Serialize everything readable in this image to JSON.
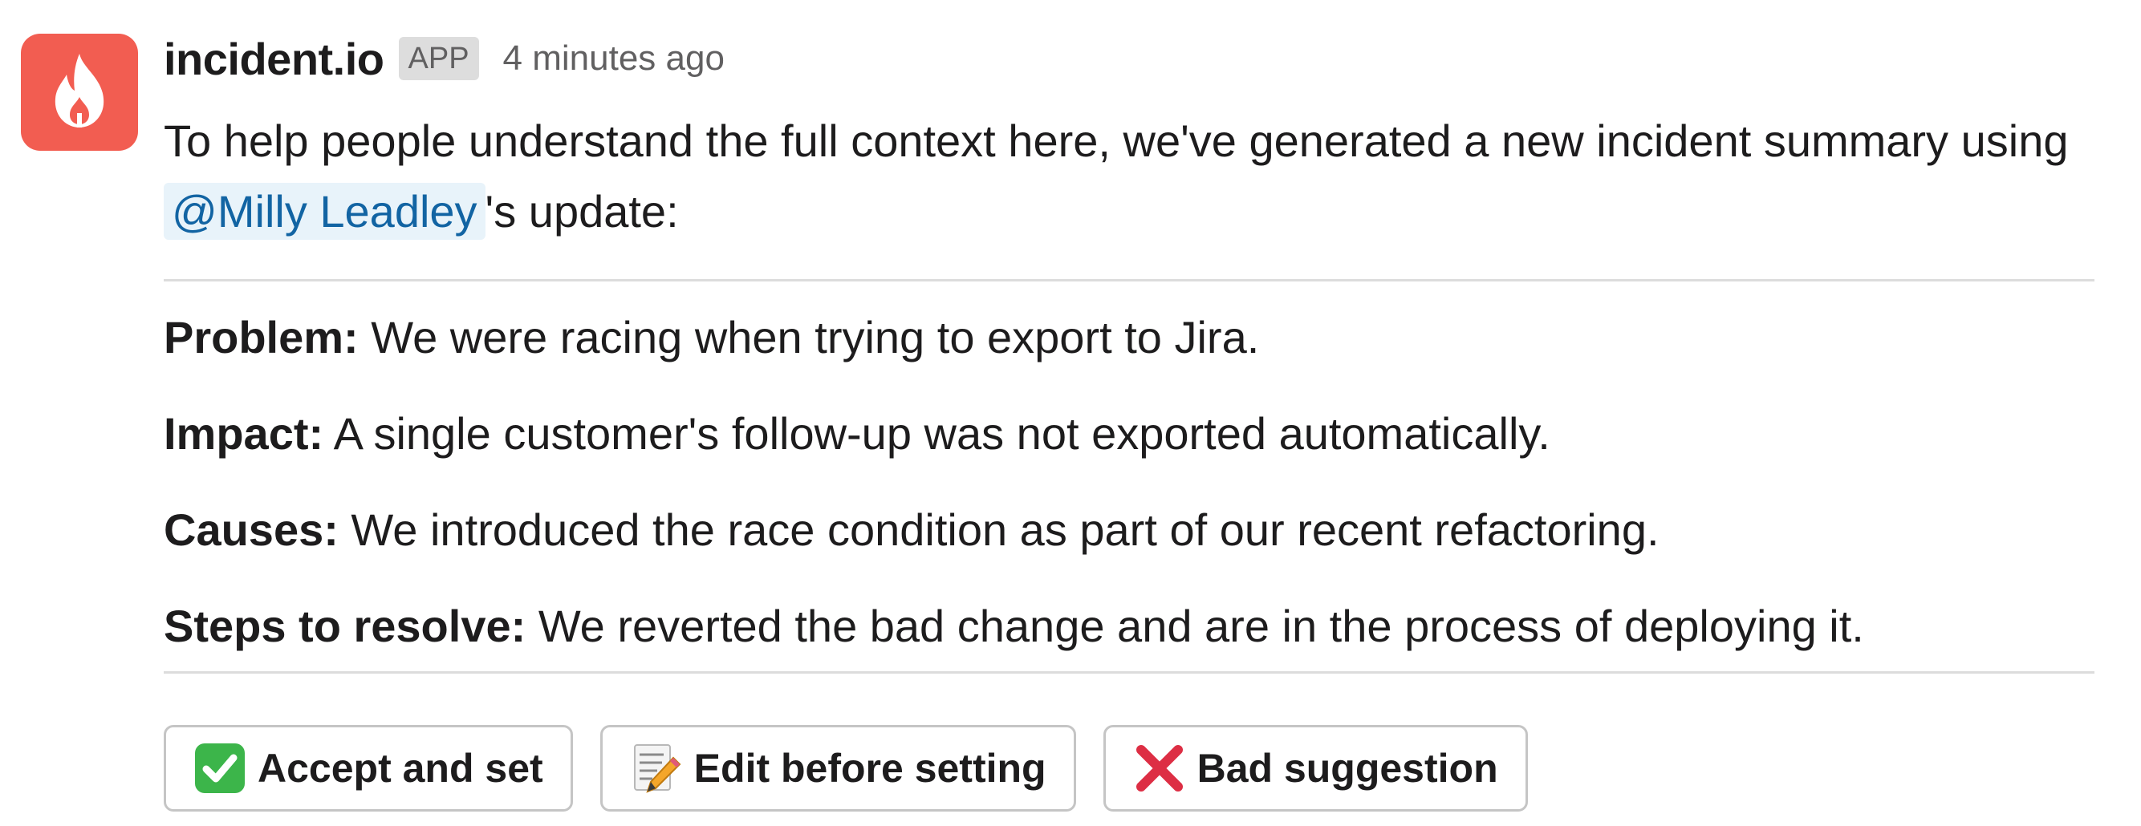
{
  "message": {
    "app_name": "incident.io",
    "app_badge": "APP",
    "timestamp": "4 minutes ago",
    "avatar_icon": "flame-icon",
    "intro_before": "To help people understand the full context here, we've generated a new incident summary using ",
    "mention": "@Milly Leadley",
    "intro_after": "'s update:"
  },
  "summary": {
    "problem": {
      "label": "Problem:",
      "text": " We were racing when trying to export to Jira."
    },
    "impact": {
      "label": "Impact:",
      "text": " A single customer's follow-up was not exported automatically."
    },
    "causes": {
      "label": "Causes:",
      "text": " We introduced the race condition as part of our recent refactoring."
    },
    "steps": {
      "label": "Steps to resolve:",
      "text": " We reverted the bad change and are in the process of deploying it."
    }
  },
  "actions": {
    "accept": {
      "label": "Accept and set",
      "icon": "check-mark-icon"
    },
    "edit": {
      "label": "Edit before setting",
      "icon": "memo-pencil-icon"
    },
    "bad": {
      "label": "Bad suggestion",
      "icon": "cross-mark-icon"
    }
  },
  "colors": {
    "avatar_bg": "#f25d51",
    "mention_bg": "#e8f3fa",
    "mention_text": "#1264a3",
    "check_green": "#3cb54a",
    "cross_red": "#dd2e44"
  }
}
